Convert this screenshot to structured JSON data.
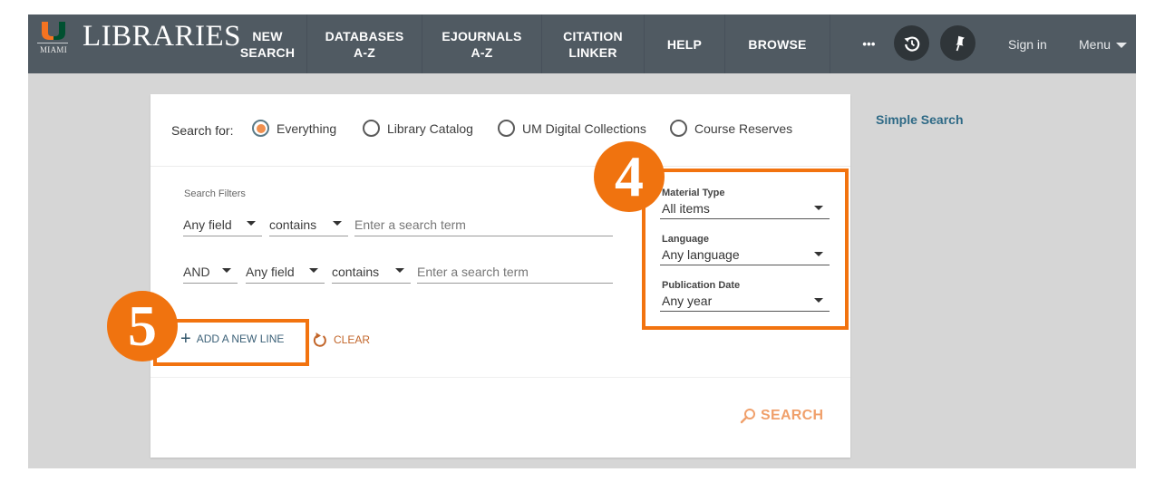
{
  "header": {
    "brand_sub": "MIAMI",
    "brand": "LIBRARIES",
    "nav": [
      {
        "line1": "NEW",
        "line2": "SEARCH"
      },
      {
        "line1": "DATABASES",
        "line2": "A-Z"
      },
      {
        "line1": "EJOURNALS",
        "line2": "A-Z"
      },
      {
        "line1": "CITATION",
        "line2": "LINKER"
      },
      {
        "line1": "HELP",
        "line2": ""
      },
      {
        "line1": "BROWSE",
        "line2": ""
      }
    ],
    "more": "•••",
    "icons": [
      "history-icon",
      "pin-icon"
    ],
    "sign_in": "Sign in",
    "menu": "Menu",
    "logo_colors": {
      "orange": "#f47321",
      "green": "#005030"
    }
  },
  "search_scope": {
    "label": "Search for:",
    "options": [
      {
        "label": "Everything",
        "selected": true
      },
      {
        "label": "Library Catalog",
        "selected": false
      },
      {
        "label": "UM Digital Collections",
        "selected": false
      },
      {
        "label": "Course Reserves",
        "selected": false
      }
    ]
  },
  "filters": {
    "title": "Search Filters",
    "rows": [
      {
        "operator": "",
        "field": "Any field",
        "precision": "contains",
        "placeholder": "Enter a search term"
      },
      {
        "operator": "AND",
        "field": "Any field",
        "precision": "contains",
        "placeholder": "Enter a search term"
      }
    ],
    "add_line": "ADD A NEW LINE",
    "clear": "CLEAR"
  },
  "facets": [
    {
      "label": "Material Type",
      "value": "All items"
    },
    {
      "label": "Language",
      "value": "Any language"
    },
    {
      "label": "Publication Date",
      "value": "Any year"
    }
  ],
  "search_button": "SEARCH",
  "simple_search_link": "Simple Search",
  "annotations": [
    {
      "number": "4",
      "target": "facets"
    },
    {
      "number": "5",
      "target": "add-a-new-line"
    }
  ],
  "colors": {
    "header_bg": "#505a62",
    "accent_orange": "#f0904f",
    "annotation_orange": "#f2730f",
    "link_blue": "#2f6a86"
  }
}
